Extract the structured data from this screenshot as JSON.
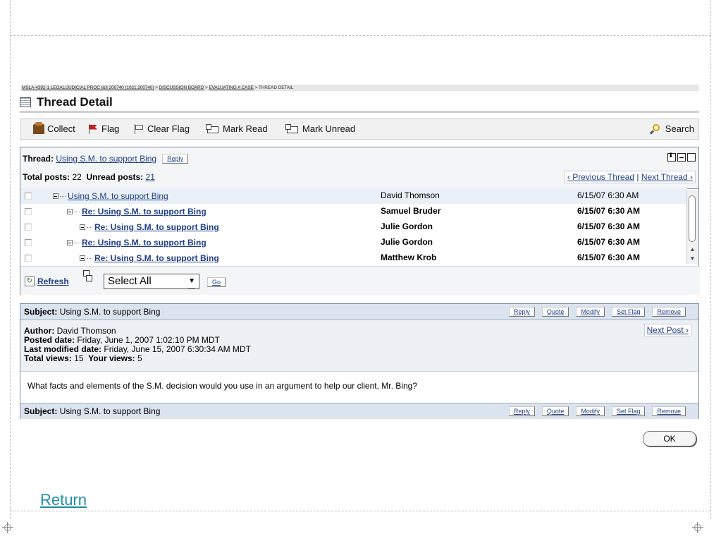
{
  "breadcrumb": {
    "course": "MSLA-4392-1 LEGAL/JUDICIAL PROC I&II 200740 (1021.200740)",
    "board": "DISCUSSION BOARD",
    "forum": "EVALUATING A CASE",
    "current": "THREAD DETAIL",
    "separator": " > "
  },
  "page_title": "Thread Detail",
  "toolbar": {
    "collect": "Collect",
    "flag": "Flag",
    "clear_flag": "Clear Flag",
    "mark_read": "Mark Read",
    "mark_unread": "Mark Unread",
    "search": "Search"
  },
  "thread": {
    "thread_label": "Thread:",
    "thread_name": "Using S.M. to support Bing",
    "reply": "Reply",
    "total_label": "Total posts:",
    "total": "22",
    "unread_label": "Unread posts:",
    "unread": "21",
    "prev": "‹ Previous Thread",
    "sep": " | ",
    "next": "Next Thread ›"
  },
  "posts": [
    {
      "title": "Using S.M. to support Bing",
      "author": "David Thomson",
      "date": "6/15/07 6:30 AM",
      "unread": false
    },
    {
      "title": "Re: Using S.M. to support Bing",
      "author": "Samuel Bruder",
      "date": "6/15/07 6:30 AM",
      "unread": true
    },
    {
      "title": "Re: Using S.M. to support Bing",
      "author": "Julie Gordon",
      "date": "6/15/07 6:30 AM",
      "unread": true
    },
    {
      "title": "Re: Using S.M. to support Bing",
      "author": "Julie Gordon",
      "date": "6/15/07 6:30 AM",
      "unread": true
    },
    {
      "title": "Re: Using S.M. to support Bing",
      "author": "Matthew Krob",
      "date": "6/15/07 6:30 AM",
      "unread": true
    }
  ],
  "list_footer": {
    "refresh": "Refresh",
    "select_value": "Select All",
    "go": "Go"
  },
  "message": {
    "subject_label": "Subject:",
    "subject": "Using S.M. to support Bing",
    "actions": {
      "reply": "Reply",
      "quote": "Quote",
      "modify": "Modify",
      "set_flag": "Set Flag",
      "remove": "Remove"
    },
    "author_label": "Author:",
    "author": "David Thomson",
    "posted_label": "Posted date:",
    "posted": "Friday, June 1, 2007 1:02:10 PM MDT",
    "modified_label": "Last modified date:",
    "modified": "Friday, June 15, 2007 6:30:34 AM MDT",
    "views_label": "Total views:",
    "views": "15",
    "your_views_label": "Your views:",
    "your_views": "5",
    "next_post": "Next Post ›",
    "body": "What facts and elements of the S.M. decision would you use in an argument to help our client, Mr. Bing?"
  },
  "ok": "OK",
  "return": "Return"
}
